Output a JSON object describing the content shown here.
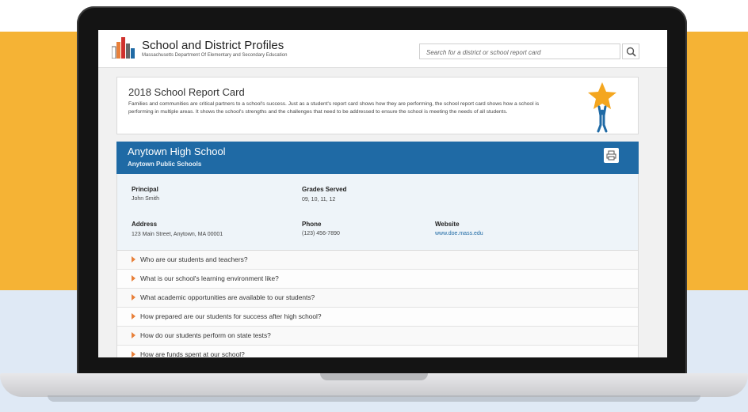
{
  "header": {
    "title": "School and District Profiles",
    "subtitle": "Massachusetts Department Of Elementary and Secondary Education",
    "search_placeholder": "Search for a district or school report card"
  },
  "intro": {
    "title": "2018 School Report Card",
    "text": "Families and communities are critical partners to a school's success. Just as a student's report card shows how they are performing, the school report card shows how a school is performing in multiple areas. It shows the school's strengths and the challenges that need to be addressed to ensure the school is meeting the needs of all students."
  },
  "school": {
    "name": "Anytown High School",
    "district": "Anytown Public Schools",
    "principal_label": "Principal",
    "principal_value": "John Smith",
    "grades_label": "Grades Served",
    "grades_value": "09, 10, 11, 12",
    "address_label": "Address",
    "address_value": "123 Main Street, Anytown, MA 00001",
    "phone_label": "Phone",
    "phone_value": "(123) 456-7890",
    "website_label": "Website",
    "website_value": "www.doe.mass.edu"
  },
  "accordion": [
    {
      "label": "Who are our students and teachers?"
    },
    {
      "label": "What is our school's learning environment like?"
    },
    {
      "label": "What academic opportunities are available to our students?"
    },
    {
      "label": "How prepared are our students for success after high school?"
    },
    {
      "label": "How do our students perform on state tests?"
    },
    {
      "label": "How are funds spent at our school?"
    }
  ],
  "colors": {
    "accent_blue": "#1f6aa5",
    "background_orange": "#f5b335",
    "accordion_arrow": "#e8803a",
    "star": "#f4a61f"
  },
  "icons": [
    "logo-books-icon",
    "search-icon",
    "star-person-icon",
    "print-icon",
    "chevron-right-icon"
  ]
}
